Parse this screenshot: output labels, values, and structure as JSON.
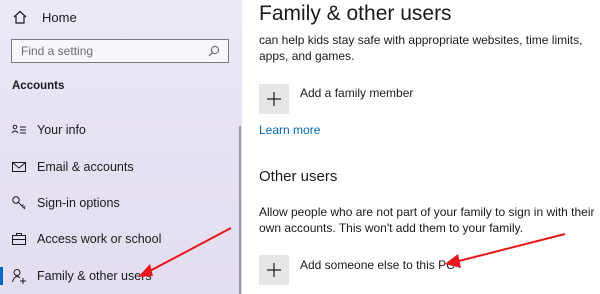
{
  "sidebar": {
    "home_label": "Home",
    "search_placeholder": "Find a setting",
    "section_title": "Accounts",
    "items": [
      {
        "label": "Your info",
        "icon": "your-info-icon"
      },
      {
        "label": "Email & accounts",
        "icon": "mail-icon"
      },
      {
        "label": "Sign-in options",
        "icon": "key-icon"
      },
      {
        "label": "Access work or school",
        "icon": "briefcase-icon"
      },
      {
        "label": "Family & other users",
        "icon": "person-icon",
        "active": true
      }
    ]
  },
  "main": {
    "page_title": "Family & other users",
    "family_description": "can help kids stay safe with appropriate websites, time limits, apps, and games.",
    "add_family_label": "Add a family member",
    "learn_more": "Learn more",
    "other_users_heading": "Other users",
    "other_users_description": "Allow people who are not part of your family to sign in with their own accounts. This won't add them to your family.",
    "add_other_label": "Add someone else to this PC"
  },
  "colors": {
    "accent": "#0067c0",
    "link": "#0067b8",
    "annotation_arrow": "#e8151b",
    "sidebar_bg": "#e7e2f2",
    "tile_bg": "#e6e6e6"
  }
}
